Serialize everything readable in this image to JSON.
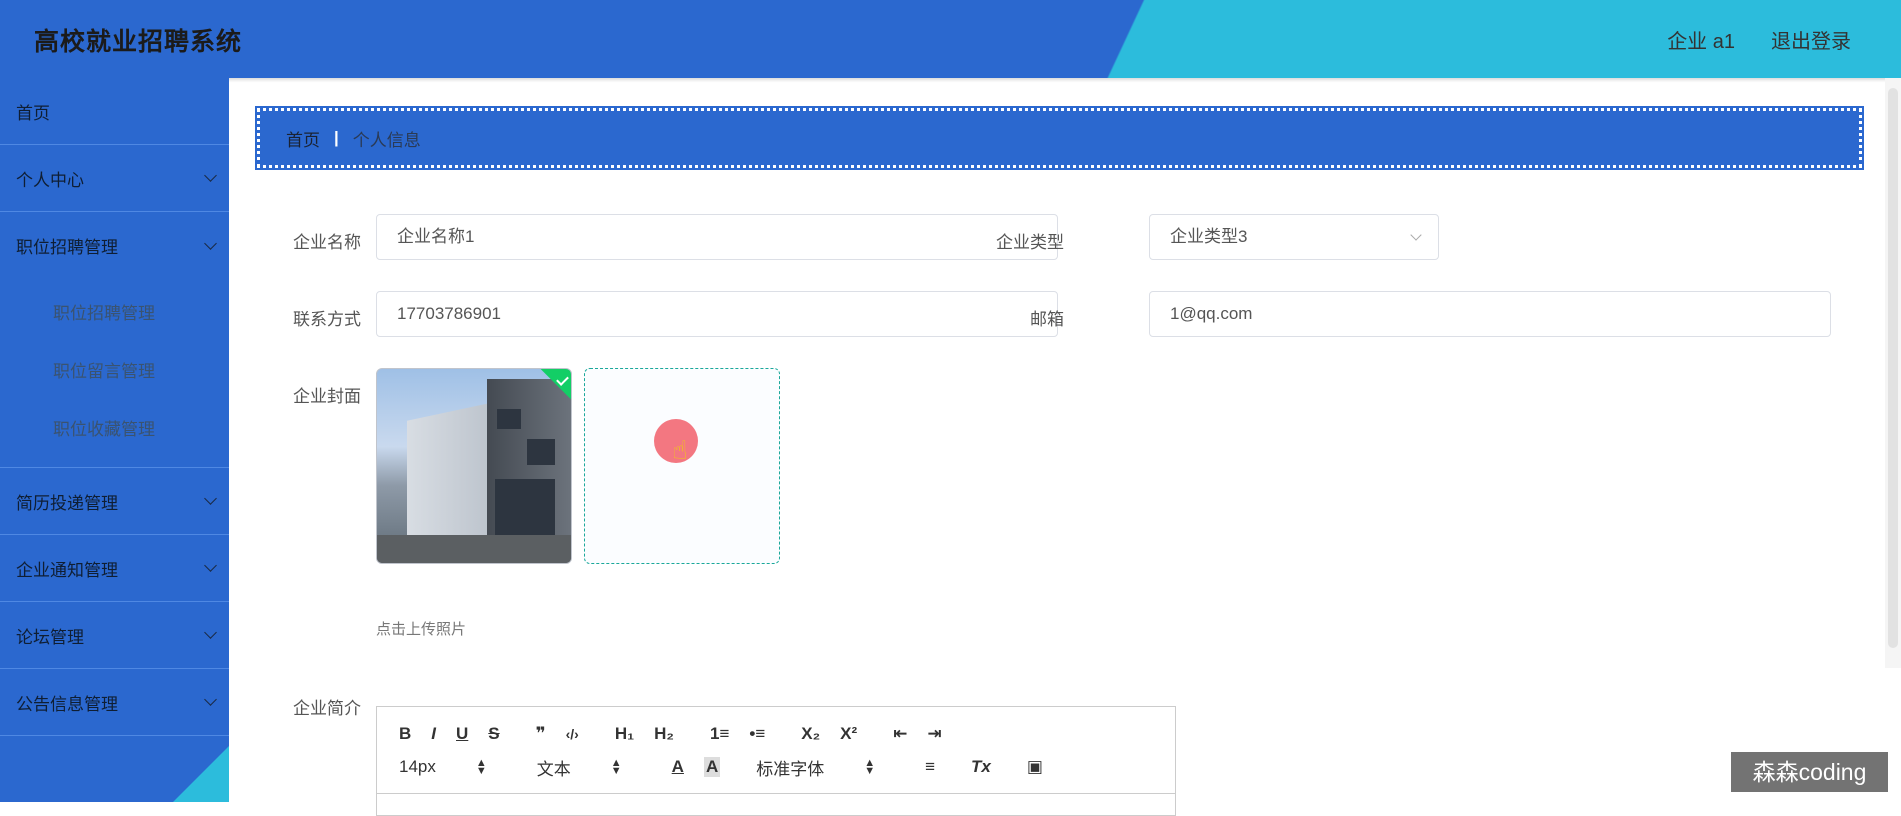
{
  "header": {
    "app_title": "高校就业招聘系统",
    "user_label": "企业 a1",
    "logout_label": "退出登录"
  },
  "sidebar": {
    "items": [
      {
        "label": "首页"
      },
      {
        "label": "个人中心"
      },
      {
        "label": "职位招聘管理",
        "children": [
          "职位招聘管理",
          "职位留言管理",
          "职位收藏管理"
        ]
      },
      {
        "label": "简历投递管理"
      },
      {
        "label": "企业通知管理"
      },
      {
        "label": "论坛管理"
      },
      {
        "label": "公告信息管理"
      }
    ]
  },
  "breadcrumb": {
    "home": "首页",
    "separator": "|",
    "current": "个人信息"
  },
  "form": {
    "company_name_label": "企业名称",
    "company_name_value": "企业名称1",
    "company_type_label": "企业类型",
    "company_type_value": "企业类型3",
    "contact_label": "联系方式",
    "contact_value": "17703786901",
    "email_label": "邮箱",
    "email_value": "1@qq.com",
    "cover_label": "企业封面",
    "upload_hint": "点击上传照片",
    "intro_label": "企业简介"
  },
  "editor": {
    "row1": [
      "B",
      "I",
      "U",
      "S",
      "❞",
      "‹/›",
      "H₁",
      "H₂",
      "1≡",
      "•≡",
      "X₂",
      "X²",
      "⇤",
      "⇥"
    ],
    "font_size": "14px",
    "paragraph": "文本",
    "font_family": "标准字体",
    "color_glyph": "A",
    "bg_glyph": "A",
    "clear_glyph": "Tx"
  },
  "watermark": "森森coding",
  "colors": {
    "primary": "#2b68cf",
    "accent": "#2cbcdc",
    "success": "#13ce66"
  }
}
